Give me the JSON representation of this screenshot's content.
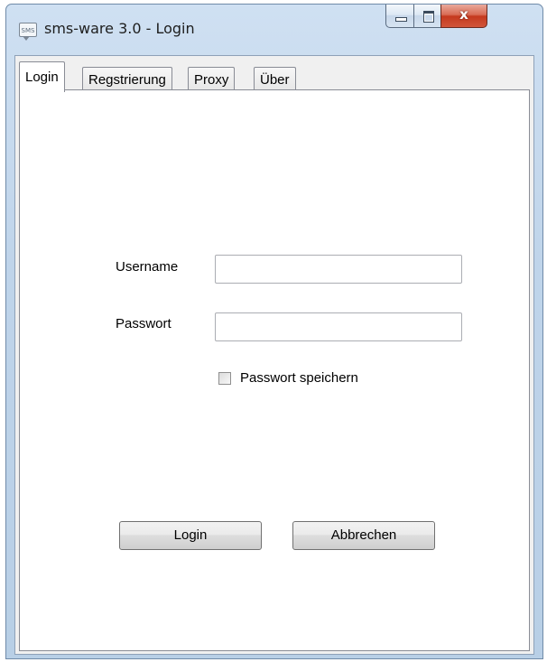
{
  "window": {
    "title": "sms-ware 3.0 - Login",
    "icon_text": "SMS",
    "controls": {
      "minimize_icon": "minimize-icon",
      "maximize_icon": "maximize-icon",
      "close_glyph": "x"
    }
  },
  "tabs": [
    {
      "label": "Login",
      "active": true
    },
    {
      "label": "Regstrierung",
      "active": false
    },
    {
      "label": "Proxy",
      "active": false
    },
    {
      "label": "Über",
      "active": false
    }
  ],
  "form": {
    "username_label": "Username",
    "username_value": "",
    "password_label": "Passwort",
    "password_value": "",
    "remember_label": "Passwort speichern",
    "remember_checked": false
  },
  "buttons": {
    "login": "Login",
    "cancel": "Abbrechen"
  },
  "colors": {
    "frame": "#bfd4ea",
    "close_button": "#c4391e"
  }
}
